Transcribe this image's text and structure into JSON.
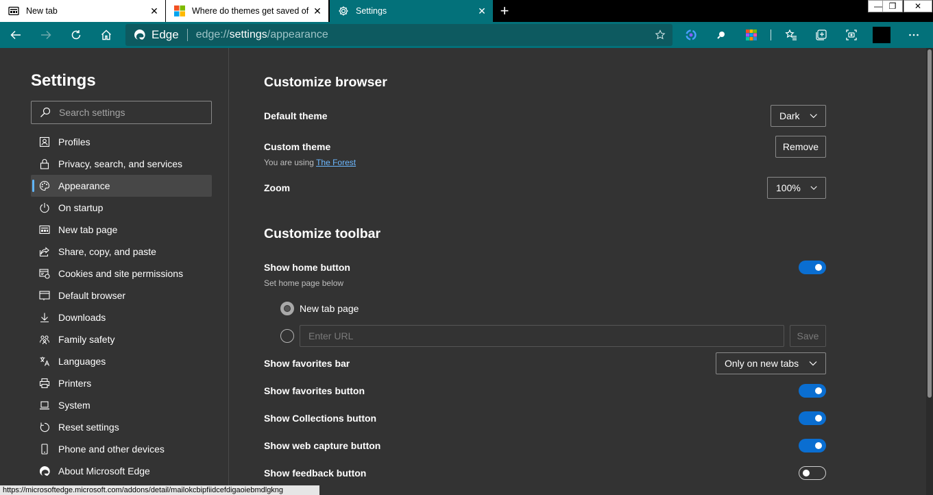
{
  "tabs": [
    {
      "title": "New tab",
      "icon": "newtab-page-icon"
    },
    {
      "title": "Where do themes get saved of M",
      "icon": "microsoft-logo-icon"
    },
    {
      "title": "Settings",
      "icon": "gear-icon"
    }
  ],
  "address": {
    "edge_label": "Edge",
    "url_scheme": "edge://",
    "url_host": "settings",
    "url_path": "/appearance"
  },
  "sidebar": {
    "title": "Settings",
    "search_placeholder": "Search settings",
    "items": [
      {
        "label": "Profiles",
        "icon": "profile-icon"
      },
      {
        "label": "Privacy, search, and services",
        "icon": "lock-icon"
      },
      {
        "label": "Appearance",
        "icon": "palette-icon",
        "active": true
      },
      {
        "label": "On startup",
        "icon": "power-icon"
      },
      {
        "label": "New tab page",
        "icon": "newtab-icon"
      },
      {
        "label": "Share, copy, and paste",
        "icon": "share-icon"
      },
      {
        "label": "Cookies and site permissions",
        "icon": "cookies-icon"
      },
      {
        "label": "Default browser",
        "icon": "browser-icon"
      },
      {
        "label": "Downloads",
        "icon": "download-icon"
      },
      {
        "label": "Family safety",
        "icon": "family-icon"
      },
      {
        "label": "Languages",
        "icon": "languages-icon"
      },
      {
        "label": "Printers",
        "icon": "printer-icon"
      },
      {
        "label": "System",
        "icon": "laptop-icon"
      },
      {
        "label": "Reset settings",
        "icon": "reset-icon"
      },
      {
        "label": "Phone and other devices",
        "icon": "phone-icon"
      },
      {
        "label": "About Microsoft Edge",
        "icon": "edge-logo-icon"
      }
    ]
  },
  "main": {
    "customize_browser": {
      "title": "Customize browser",
      "default_theme_label": "Default theme",
      "default_theme_value": "Dark",
      "custom_theme_label": "Custom theme",
      "custom_theme_sub_prefix": "You are using",
      "custom_theme_link": "The Forest",
      "remove_label": "Remove",
      "zoom_label": "Zoom",
      "zoom_value": "100%"
    },
    "customize_toolbar": {
      "title": "Customize toolbar",
      "home_button_label": "Show home button",
      "home_button_sub": "Set home page below",
      "home_button_on": true,
      "radio_newtab_label": "New tab page",
      "url_placeholder": "Enter URL",
      "save_label": "Save",
      "favorites_bar_label": "Show favorites bar",
      "favorites_bar_value": "Only on new tabs",
      "favorites_button_label": "Show favorites button",
      "favorites_button_on": true,
      "collections_button_label": "Show Collections button",
      "collections_button_on": true,
      "web_capture_label": "Show web capture button",
      "web_capture_on": true,
      "feedback_label": "Show feedback button",
      "feedback_on": false
    }
  },
  "status_url": "https://microsoftedge.microsoft.com/addons/detail/mailokcbipfiidcefdigaoiebmdlgkng",
  "colors": {
    "accent": "#03717a",
    "toggle_on": "#0a6ed1",
    "link": "#6cb8ff",
    "active_indicator": "#61b6ff"
  }
}
